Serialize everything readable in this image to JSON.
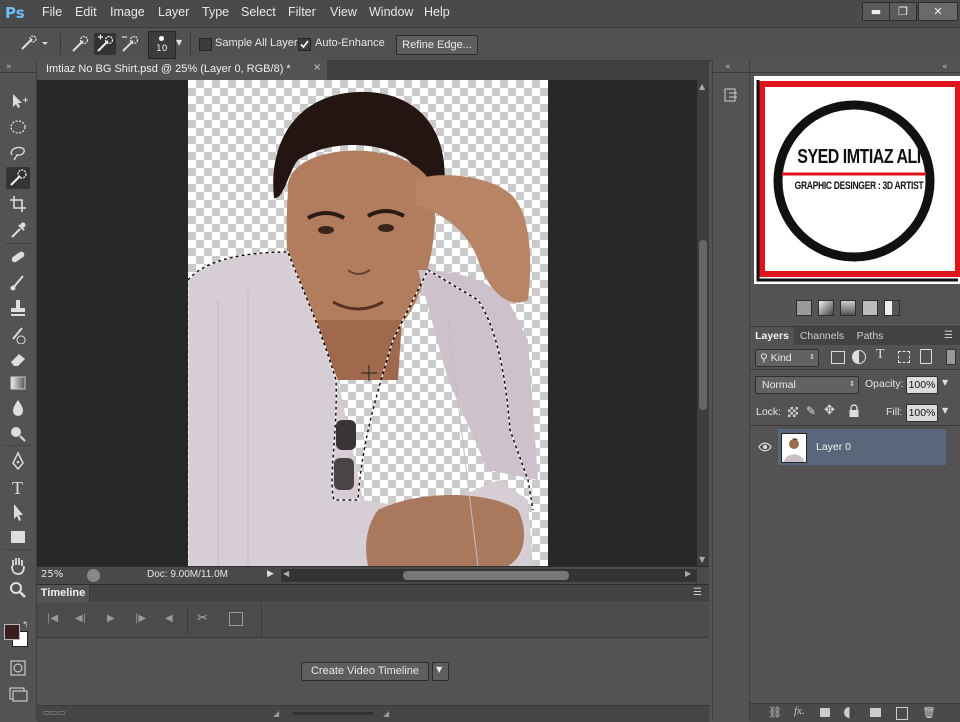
{
  "app": {
    "logo": "Ps"
  },
  "menu": [
    "File",
    "Edit",
    "Image",
    "Layer",
    "Type",
    "Select",
    "Filter",
    "View",
    "Window",
    "Help"
  ],
  "window_controls": [
    "minimize-icon",
    "restore-icon",
    "close-icon"
  ],
  "options": {
    "brush_size": "10",
    "sample_all_layers": {
      "label": "Sample All Layers",
      "checked": false
    },
    "auto_enhance": {
      "label": "Auto-Enhance",
      "checked": true
    },
    "refine_edge": "Refine Edge..."
  },
  "document": {
    "tab_title": "Imtiaz No BG Shirt.psd @ 25% (Layer 0, RGB/8) *",
    "zoom": "25%",
    "doc_info": "Doc: 9.00M/11.0M"
  },
  "timeline": {
    "tab": "Timeline",
    "create_button": "Create Video Timeline"
  },
  "logo_image": {
    "line1": "SYED IMTIAZ ALI",
    "line2": "GRAPHIC DESINGER : 3D ARTIST",
    "colors": {
      "frame": "#e0141b",
      "ring": "#111111",
      "underline": "#e0141b"
    }
  },
  "layers_panel": {
    "tabs": [
      "Layers",
      "Channels",
      "Paths"
    ],
    "filter_kind": "Kind",
    "blend_mode": "Normal",
    "opacity_label": "Opacity:",
    "opacity": "100%",
    "lock_label": "Lock:",
    "fill_label": "Fill:",
    "fill": "100%",
    "layers": [
      {
        "name": "Layer 0",
        "visible": true,
        "selected": true
      }
    ]
  },
  "colors": {
    "accent_selection": "#58677a",
    "panel_bg": "#535353",
    "canvas_bg": "#282828"
  }
}
